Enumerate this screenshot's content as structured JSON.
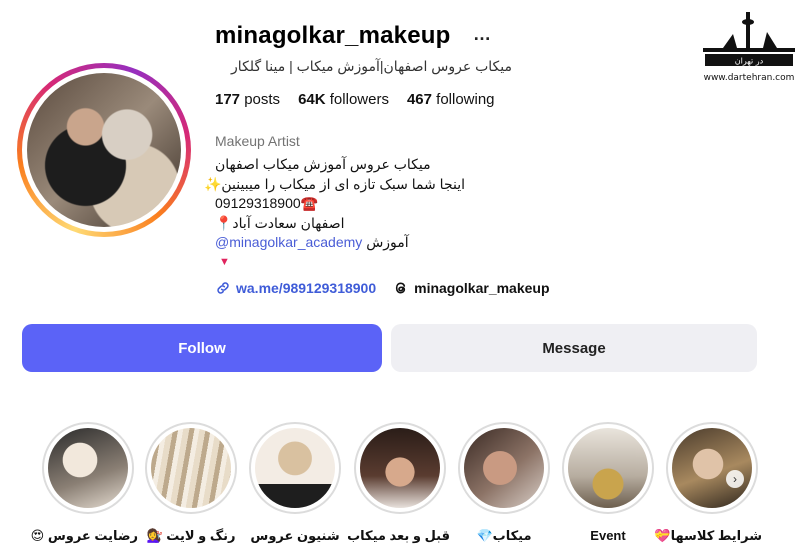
{
  "profile": {
    "username": "minagolkar_makeup",
    "more": "…",
    "full_name": "میکاب عروس اصفهان|آموزش میکاب | مینا گلکار",
    "stats": {
      "posts_count": "177",
      "posts_label": "posts",
      "followers_count": "64K",
      "followers_label": "followers",
      "following_count": "467",
      "following_label": "following"
    },
    "category": "Makeup Artist",
    "bio": {
      "line1": "میکاب عروس آموزش میکاب اصفهان",
      "line2": "اینجا شما سبک تازه ای از میکاب را میبینین✨",
      "line3": "09129318900☎️",
      "line4": "اصفهان سعادت آباد📍",
      "line5_text": "آموزش",
      "line5_mention": "minagolkar_academy@",
      "line6": "▼"
    },
    "links": {
      "whatsapp": "wa.me/989129318900",
      "threads": "minagolkar_makeup"
    }
  },
  "actions": {
    "follow": "Follow",
    "message": "Message"
  },
  "highlights": [
    {
      "label": "شرایط کلاسها💝"
    },
    {
      "label": "Event"
    },
    {
      "label": "میکاب💎"
    },
    {
      "label": "قبل و بعد میکاب"
    },
    {
      "label": "شنیون عروس"
    },
    {
      "label": "رنگ و لایت 💇‍♀️"
    },
    {
      "label": "رضایت عروس 😍"
    }
  ],
  "watermark": {
    "logo_text": "در تهران",
    "url": "www.dartehran.com"
  },
  "colors": {
    "follow_button": "#5b63f7",
    "message_button": "#efeff3",
    "link": "#3f5cd8"
  }
}
